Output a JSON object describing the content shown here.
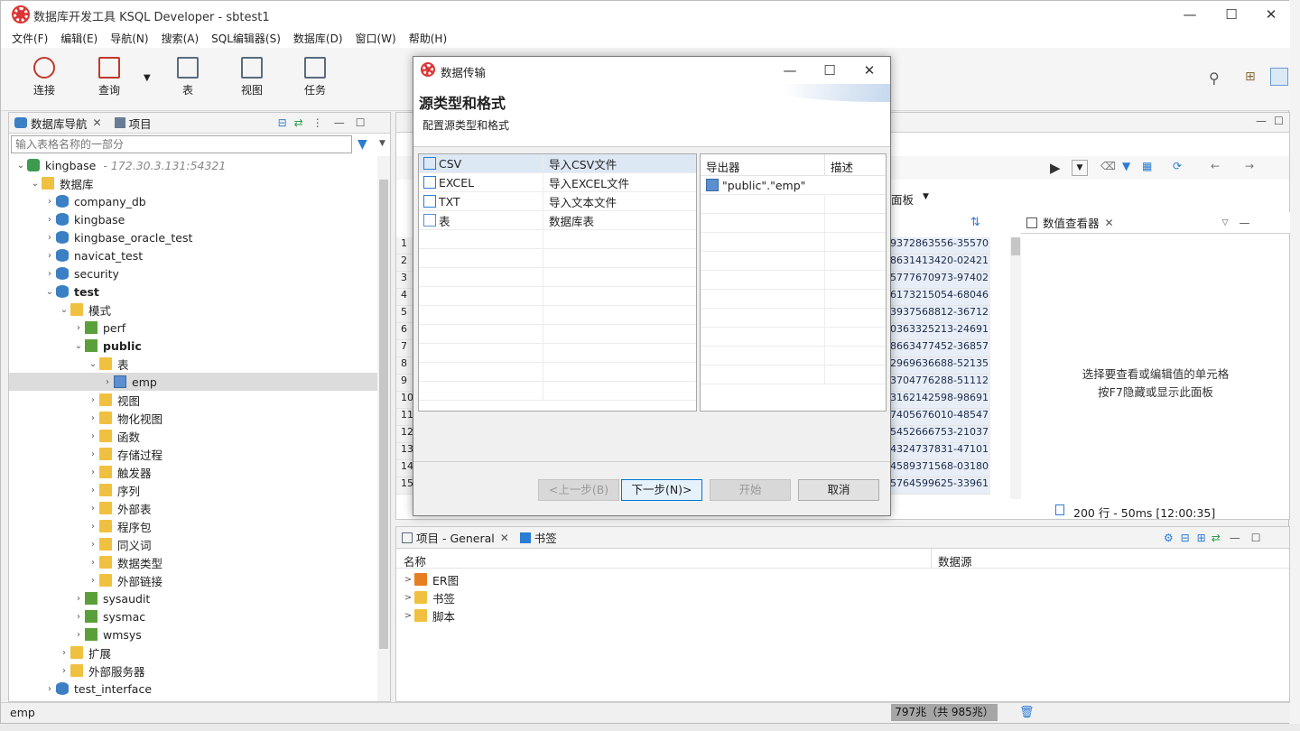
{
  "window": {
    "title": "数据库开发工具 KSQL Developer - sbtest1"
  },
  "menu": [
    "文件(F)",
    "编辑(E)",
    "导航(N)",
    "搜索(A)",
    "SQL编辑器(S)",
    "数据库(D)",
    "窗口(W)",
    "帮助(H)"
  ],
  "toolbar": {
    "connect": "连接",
    "query": "查询",
    "table": "表",
    "view": "视图",
    "task": "任务"
  },
  "navigator": {
    "tab_nav": "数据库导航",
    "tab_project": "项目",
    "filter_placeholder": "输入表格名称的一部分",
    "tree": [
      {
        "label": "kingbase",
        "extra": "- 172.30.3.131:54321",
        "level": 0,
        "arrow": "v",
        "icon": "conn"
      },
      {
        "label": "数据库",
        "level": 1,
        "arrow": "v",
        "icon": "folder"
      },
      {
        "label": "company_db",
        "level": 2,
        "arrow": ">",
        "icon": "db"
      },
      {
        "label": "kingbase",
        "level": 2,
        "arrow": ">",
        "icon": "db"
      },
      {
        "label": "kingbase_oracle_test",
        "level": 2,
        "arrow": ">",
        "icon": "db"
      },
      {
        "label": "navicat_test",
        "level": 2,
        "arrow": ">",
        "icon": "db"
      },
      {
        "label": "security",
        "level": 2,
        "arrow": ">",
        "icon": "db"
      },
      {
        "label": "test",
        "level": 2,
        "arrow": "v",
        "icon": "db",
        "bold": true
      },
      {
        "label": "模式",
        "level": 3,
        "arrow": "v",
        "icon": "folder"
      },
      {
        "label": "perf",
        "level": 4,
        "arrow": ">",
        "icon": "schema"
      },
      {
        "label": "public",
        "level": 4,
        "arrow": "v",
        "icon": "schema",
        "bold": true
      },
      {
        "label": "表",
        "level": 5,
        "arrow": "v",
        "icon": "folder"
      },
      {
        "label": "emp",
        "level": 6,
        "arrow": ">",
        "icon": "table",
        "selected": true
      },
      {
        "label": "视图",
        "level": 5,
        "arrow": ">",
        "icon": "folder"
      },
      {
        "label": "物化视图",
        "level": 5,
        "arrow": ">",
        "icon": "folder"
      },
      {
        "label": "函数",
        "level": 5,
        "arrow": ">",
        "icon": "folder"
      },
      {
        "label": "存储过程",
        "level": 5,
        "arrow": ">",
        "icon": "folder"
      },
      {
        "label": "触发器",
        "level": 5,
        "arrow": ">",
        "icon": "folder"
      },
      {
        "label": "序列",
        "level": 5,
        "arrow": ">",
        "icon": "folder"
      },
      {
        "label": "外部表",
        "level": 5,
        "arrow": ">",
        "icon": "folder"
      },
      {
        "label": "程序包",
        "level": 5,
        "arrow": ">",
        "icon": "folder"
      },
      {
        "label": "同义词",
        "level": 5,
        "arrow": ">",
        "icon": "folder"
      },
      {
        "label": "数据类型",
        "level": 5,
        "arrow": ">",
        "icon": "folder"
      },
      {
        "label": "外部链接",
        "level": 5,
        "arrow": ">",
        "icon": "folder"
      },
      {
        "label": "sysaudit",
        "level": 4,
        "arrow": ">",
        "icon": "schema"
      },
      {
        "label": "sysmac",
        "level": 4,
        "arrow": ">",
        "icon": "schema"
      },
      {
        "label": "wmsys",
        "level": 4,
        "arrow": ">",
        "icon": "schema"
      },
      {
        "label": "扩展",
        "level": 3,
        "arrow": ">",
        "icon": "folder"
      },
      {
        "label": "外部服务器",
        "level": 3,
        "arrow": ">",
        "icon": "folder"
      },
      {
        "label": "test_interface",
        "level": 2,
        "arrow": ">",
        "icon": "db"
      }
    ]
  },
  "editor": {
    "panel_label": "面板",
    "row_numbers": [
      "1",
      "2",
      "3",
      "4",
      "5",
      "6",
      "7",
      "8",
      "9",
      "10",
      "11",
      "12",
      "13",
      "14",
      "15"
    ],
    "values": [
      "3-59372863556-35570",
      "9-28631413420-02421",
      "4-95777670973-97402",
      "2-46173215054-68046",
      "9-93937568812-36712",
      "5-60363325213-24691",
      "3-38663477452-36857",
      "2-52969636688-52135",
      "5-53704776288-51112",
      "2-63162142598-98691",
      "4-37405676010-48547",
      "2-45452666753-21037",
      "0-84324737831-47101",
      "-04589371568-03180",
      "4-55764599625-33961"
    ],
    "viewer_tab": "数值查看器",
    "viewer_hint_1": "选择要查看或编辑值的单元格",
    "viewer_hint_2": "按F7隐藏或显示此面板",
    "row_count": "200 行 - 50ms [12:00:35]"
  },
  "project_panel": {
    "tab_project": "项目 - General",
    "tab_bookmark": "书签",
    "col_name": "名称",
    "col_source": "数据源",
    "items": [
      "ER图",
      "书签",
      "脚本"
    ]
  },
  "status": {
    "left": "emp",
    "memory": "797兆（共 985兆）"
  },
  "dialog": {
    "title": "数据传输",
    "heading": "源类型和格式",
    "subheading": "配置源类型和格式",
    "sources": [
      {
        "name": "CSV",
        "desc": "导入CSV文件",
        "icon": "csv-icon",
        "selected": true
      },
      {
        "name": "EXCEL",
        "desc": "导入EXCEL文件",
        "icon": "excel-icon"
      },
      {
        "name": "TXT",
        "desc": "导入文本文件",
        "icon": "txt-icon"
      },
      {
        "name": "表",
        "desc": "数据库表",
        "icon": "table-icon"
      }
    ],
    "exporter_col": "导出器",
    "desc_col": "描述",
    "exporter_value": "\"public\".\"emp\"",
    "btn_prev": "<上一步(B)",
    "btn_next": "下一步(N)>",
    "btn_start": "开始",
    "btn_cancel": "取消"
  }
}
